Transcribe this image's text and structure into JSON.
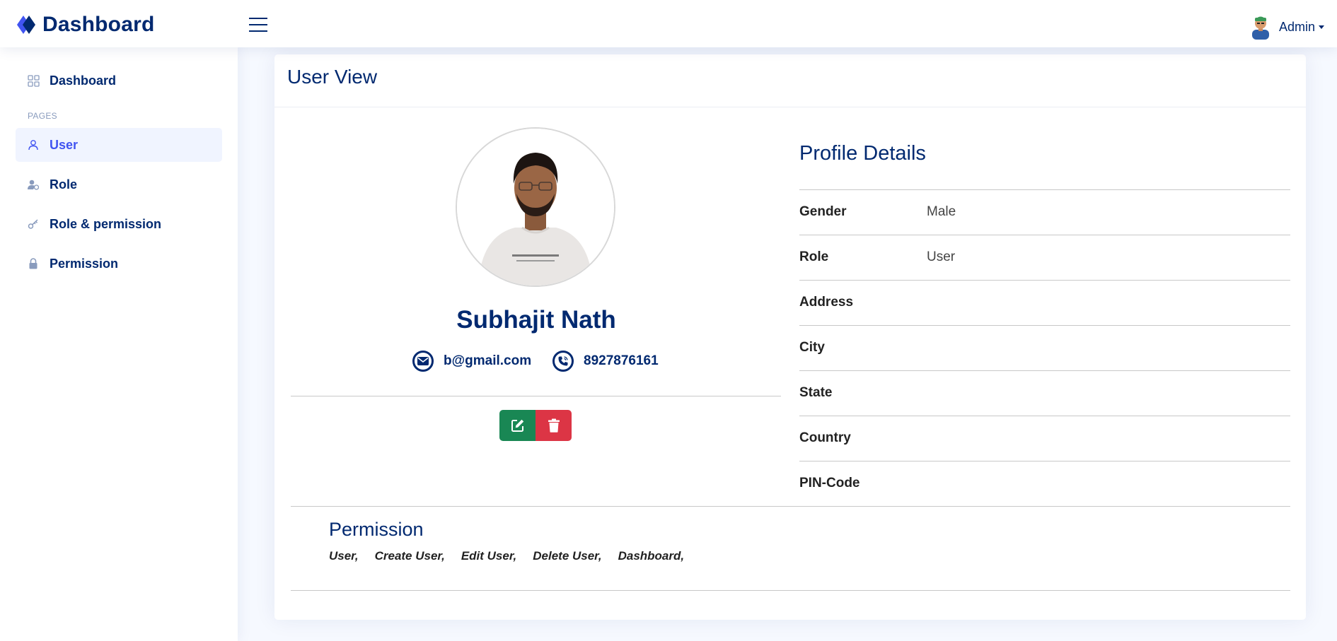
{
  "header": {
    "title": "Dashboard",
    "admin_name": "Admin"
  },
  "sidebar": {
    "heading": "PAGES",
    "items": [
      {
        "label": "Dashboard",
        "icon": "grid-icon"
      },
      {
        "label": "User",
        "icon": "person-icon",
        "active": true
      },
      {
        "label": "Role",
        "icon": "person-badge-icon"
      },
      {
        "label": "Role & permission",
        "icon": "key-icon"
      },
      {
        "label": "Permission",
        "icon": "lock-icon"
      }
    ]
  },
  "card": {
    "title": "User View"
  },
  "user": {
    "name": "Subhajit Nath",
    "email": "b@gmail.com",
    "phone": "8927876161"
  },
  "profile": {
    "title": "Profile Details",
    "rows": [
      {
        "label": "Gender",
        "value": "Male"
      },
      {
        "label": "Role",
        "value": "User"
      },
      {
        "label": "Address",
        "value": ""
      },
      {
        "label": "City",
        "value": ""
      },
      {
        "label": "State",
        "value": ""
      },
      {
        "label": "Country",
        "value": ""
      },
      {
        "label": "PIN-Code",
        "value": ""
      }
    ]
  },
  "permission": {
    "title": "Permission",
    "items": [
      "User,",
      "Create User,",
      "Edit User,",
      "Delete User,",
      "Dashboard,"
    ]
  },
  "colors": {
    "primary": "#012970",
    "accent": "#4154f1",
    "edit": "#198754",
    "delete": "#dc3545",
    "page_bg": "#f6f9ff"
  }
}
